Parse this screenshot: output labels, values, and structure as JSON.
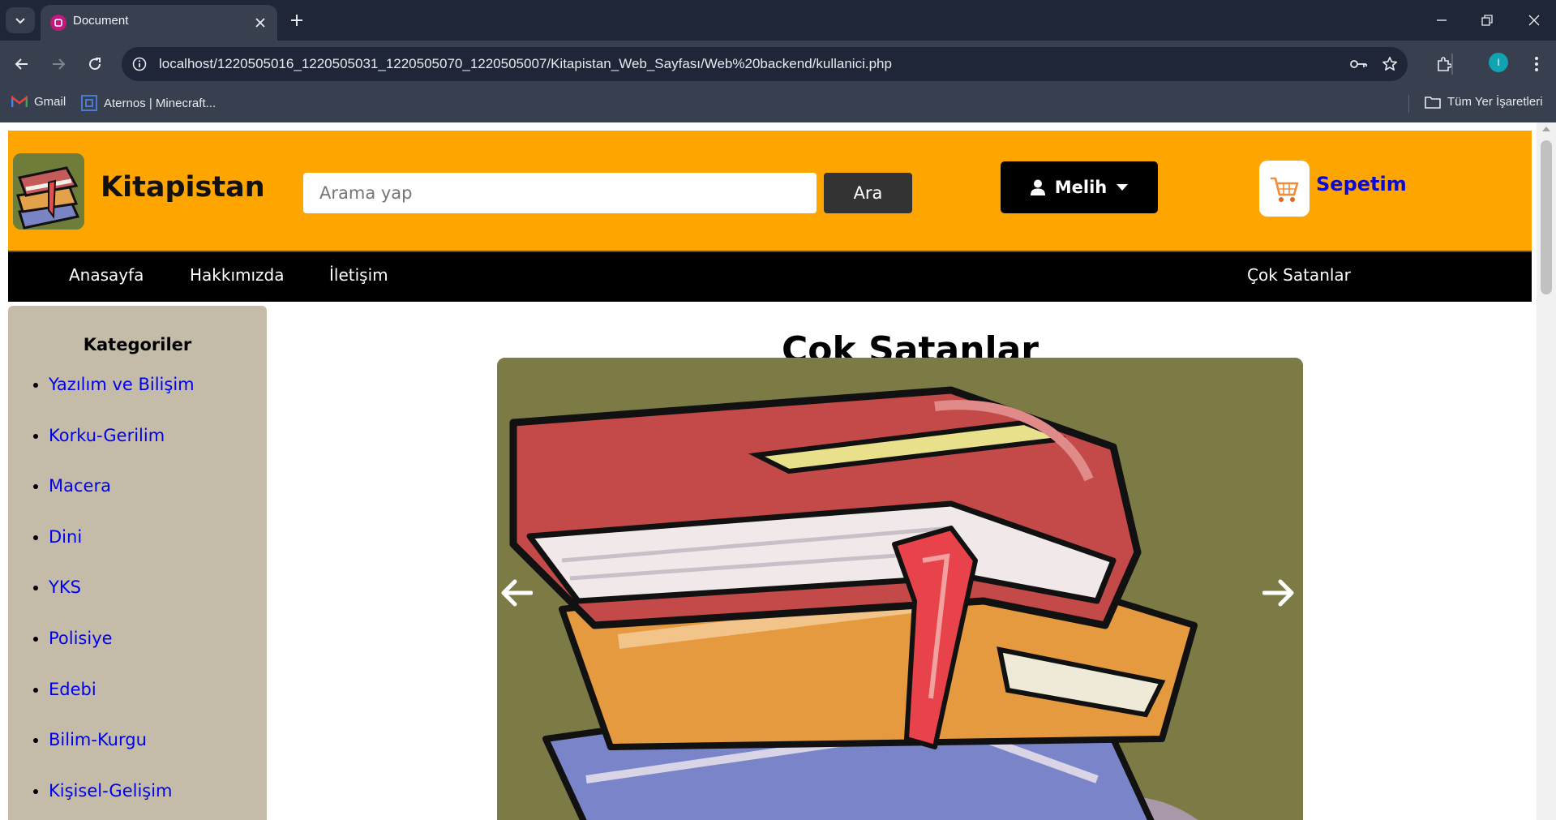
{
  "browser": {
    "tab_title": "Document",
    "url": "localhost/1220505016_1220505031_1220505070_1220505007/Kitapistan_Web_Sayfası/Web%20backend/kullanici.php",
    "profile_initial": "I",
    "bookmarks": [
      {
        "label": "Gmail",
        "icon": "gmail-icon"
      },
      {
        "label": "Aternos | Minecraft...",
        "icon": "aternos-icon"
      }
    ],
    "all_bookmarks_label": "Tüm Yer İşaretleri",
    "colors": {
      "frame": "#1f2638",
      "toolbar": "#383f4f",
      "favicon": "#c2187e",
      "profile": "#10a3b1"
    }
  },
  "site": {
    "name": "Kitapistan",
    "search": {
      "placeholder": "Arama yap",
      "button": "Ara"
    },
    "user_menu": {
      "label": "Melih",
      "icon": "user-icon",
      "caret": "caret-down-icon"
    },
    "cart": {
      "label": "Sepetim",
      "icon": "shopping-cart-icon"
    },
    "nav": [
      {
        "label": "Anasayfa"
      },
      {
        "label": "Hakkımızda"
      },
      {
        "label": "İletişim"
      },
      {
        "label": "Çok Satanlar"
      }
    ],
    "sidebar": {
      "title": "Kategoriler",
      "categories": [
        "Yazılım ve Bilişim",
        "Korku-Gerilim",
        "Macera",
        "Dini",
        "YKS",
        "Polisiye",
        "Edebi",
        "Bilim-Kurgu",
        "Kişisel-Gelişim"
      ]
    },
    "content": {
      "title": "Çok Satanlar",
      "slider_image": "book-stack-illustration",
      "prev_icon": "arrow-left-icon",
      "next_icon": "arrow-right-icon"
    },
    "colors": {
      "header": "#ffa500",
      "nav": "#000000",
      "sidebar": "#c4bca9",
      "link": "#0000ee",
      "cart_link": "#0a0ad6"
    }
  }
}
